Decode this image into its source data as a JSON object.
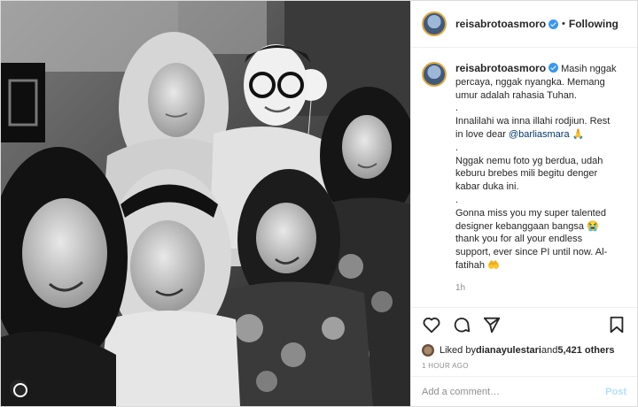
{
  "header": {
    "username": "reisabrotoasmoro",
    "separator": "•",
    "follow_label": "Following"
  },
  "caption": {
    "username": "reisabrotoasmoro",
    "line1": "Masih nggak percaya, nggak nyangka. Memang umur adalah rahasia Tuhan.",
    "dot1": ".",
    "line2": "Innalilahi wa inna illahi rodjiun. Rest in love dear ",
    "mention": "@barliasmara",
    "emoji_pray": "🙏",
    "dot2": ".",
    "line3": "Nggak nemu foto yg berdua, udah keburu brebes mili begitu denger kabar duka ini.",
    "dot3": ".",
    "line4": "Gonna miss you my super talented designer kebanggaan bangsa ",
    "emoji_cry": "😭",
    "line5": " thank you for all your endless support, ever since PI until now. Al-fatihah ",
    "emoji_hands": "🤲",
    "time": "1h"
  },
  "likes": {
    "prefix": "Liked by ",
    "user": "dianayulestari",
    "middle": " and ",
    "count": "5,421 others"
  },
  "posted_ago": "1 HOUR AGO",
  "comment_box": {
    "placeholder": "Add a comment…",
    "post_label": "Post"
  }
}
